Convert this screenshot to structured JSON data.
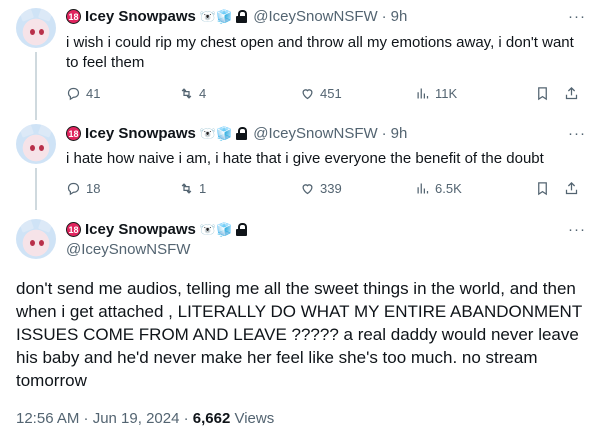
{
  "user": {
    "name": "Icey Snowpaws",
    "age_badge": "18",
    "emoji": "🐻‍❄️🧊",
    "handle": "@IceySnowNSFW"
  },
  "tweets": [
    {
      "time": "9h",
      "text": "i wish i could rip my chest open and throw all my emotions away, i don't want to feel them",
      "replies": "41",
      "reposts": "4",
      "likes": "451",
      "views": "11K"
    },
    {
      "time": "9h",
      "text": "i hate how naive i am, i hate that i give everyone the benefit of the doubt",
      "replies": "18",
      "reposts": "1",
      "likes": "339",
      "views": "6.5K"
    }
  ],
  "main": {
    "text": "don't send me audios, telling me all the sweet things in the world, and then when i get attached , LITERALLY DO WHAT MY ENTIRE ABANDONMENT ISSUES COME FROM AND LEAVE ????? a real daddy would never leave his baby and he'd never make her feel like she's too much. no stream tomorrow",
    "timestamp": "12:56 AM · Jun 19, 2024 · ",
    "views_count": "6,662",
    "views_label": " Views"
  },
  "ui": {
    "more": "···",
    "dot": "·"
  },
  "icons": [
    "reply-icon",
    "repost-icon",
    "like-icon",
    "views-icon",
    "bookmark-icon",
    "share-icon",
    "lock-icon",
    "more-icon"
  ]
}
